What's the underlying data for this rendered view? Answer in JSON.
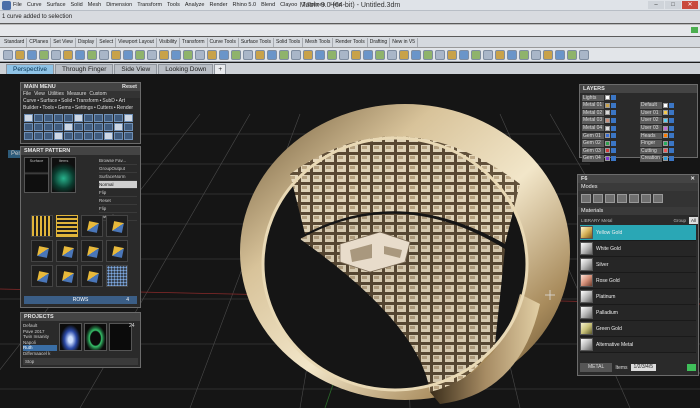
{
  "window": {
    "title": "Matrix 9.0 (64-bit) - Untitled.3dm",
    "menu": [
      "File",
      "Curve",
      "Surface",
      "Solid",
      "Mesh",
      "Dimension",
      "Transform",
      "Tools",
      "Analyze",
      "Render",
      "Rhino 5.0",
      "Blend",
      "Clayoo",
      "T-Splines",
      "Help"
    ],
    "controls": {
      "minimize": "–",
      "maximize": "□",
      "close": "✕"
    }
  },
  "command": {
    "history": "1 curve added to selection",
    "prompt": ""
  },
  "toolbar_tabs": [
    "Standard",
    "CPlanes",
    "Set View",
    "Display",
    "Select",
    "Viewport Layout",
    "Visibility",
    "Transform",
    "Curve Tools",
    "Surface Tools",
    "Solid Tools",
    "Mesh Tools",
    "Render Tools",
    "Drafting",
    "New in V5"
  ],
  "viewport_tabs": [
    {
      "label": "Perspective",
      "active": true
    },
    {
      "label": "Through Finger",
      "active": false
    },
    {
      "label": "Side View",
      "active": false
    },
    {
      "label": "Looking Down",
      "active": false
    },
    {
      "label": "+",
      "active": false
    }
  ],
  "viewport_label": "Perspective",
  "main_menu": {
    "title": "MAIN MENU",
    "reset": "Reset",
    "menu": [
      "File",
      "View",
      "Utilities",
      "Measure",
      "Custom"
    ],
    "rows": [
      [
        "Curve",
        "Surface",
        "Solid",
        "Transform",
        "SubD",
        "Art"
      ],
      [
        "Builder",
        "Tools",
        "Gems",
        "Settings",
        "Cutters",
        "Render"
      ]
    ]
  },
  "smart_pattern": {
    "title": "SMART PATTERN",
    "previews": [
      "Surface",
      "Items"
    ],
    "options": [
      "Browse Fav...",
      "GroupOutput",
      "SurfaceNorm",
      "Normal",
      "Flip",
      "Reset",
      "Flip",
      "Towards"
    ],
    "selected_option": "Normal",
    "rows_label": "ROWS",
    "rows_value": "4"
  },
  "projects": {
    "title": "PROJECTS",
    "items": [
      "Default",
      "Pave 2017",
      "Twin Insanity",
      "Napoli",
      "Ruth",
      "Differnaacel k"
    ],
    "selected": "Ruth",
    "count": "24",
    "stop": "Stop"
  },
  "layers": {
    "title": "LAYERS",
    "left": [
      "Lights",
      "Metal 01",
      "Metal 02",
      "Metal 03",
      "Metal 04",
      "Gem 01",
      "Gem 02",
      "Gem 03",
      "Gem 04"
    ],
    "right": [
      "",
      "Default",
      "User 01",
      "User 02",
      "User 03",
      "Heads",
      "Finger",
      "Cutting",
      "Creation"
    ]
  },
  "f6": {
    "title": "F6",
    "modes_label": "Modes",
    "materials_label": "Materials",
    "filter_label": "LIBRARY Metal",
    "group_label": "Group",
    "group_value": "All",
    "materials": [
      "Yellow Gold",
      "White Gold",
      "Silver",
      "Rose Gold",
      "Platinum",
      "Palladium",
      "Green Gold",
      "Alternative Metal"
    ],
    "selected": "Yellow Gold",
    "footer_label": "METAL",
    "footer_value1": "Items",
    "footer_value2": "1/2/3/4/5"
  }
}
